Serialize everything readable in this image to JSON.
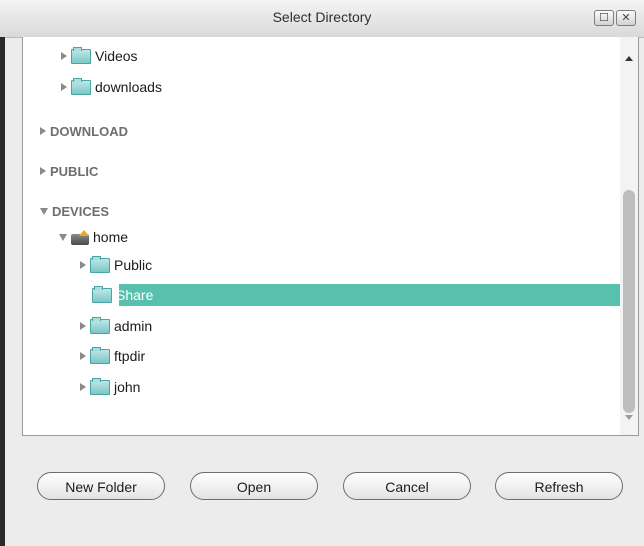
{
  "window": {
    "title": "Select Directory"
  },
  "tree": {
    "items": [
      {
        "label": "Videos"
      },
      {
        "label": "downloads"
      },
      {
        "label": "DOWNLOAD"
      },
      {
        "label": "PUBLIC"
      },
      {
        "label": "DEVICES"
      },
      {
        "label": "home"
      },
      {
        "label": "Public"
      },
      {
        "label": "Share"
      },
      {
        "label": "admin"
      },
      {
        "label": "ftpdir"
      },
      {
        "label": "john"
      }
    ],
    "selected": "Share"
  },
  "buttons": {
    "new_folder": "New Folder",
    "open": "Open",
    "cancel": "Cancel",
    "refresh": "Refresh"
  },
  "colors": {
    "selection": "#58c1ad",
    "folder": "#7bc7c7"
  }
}
